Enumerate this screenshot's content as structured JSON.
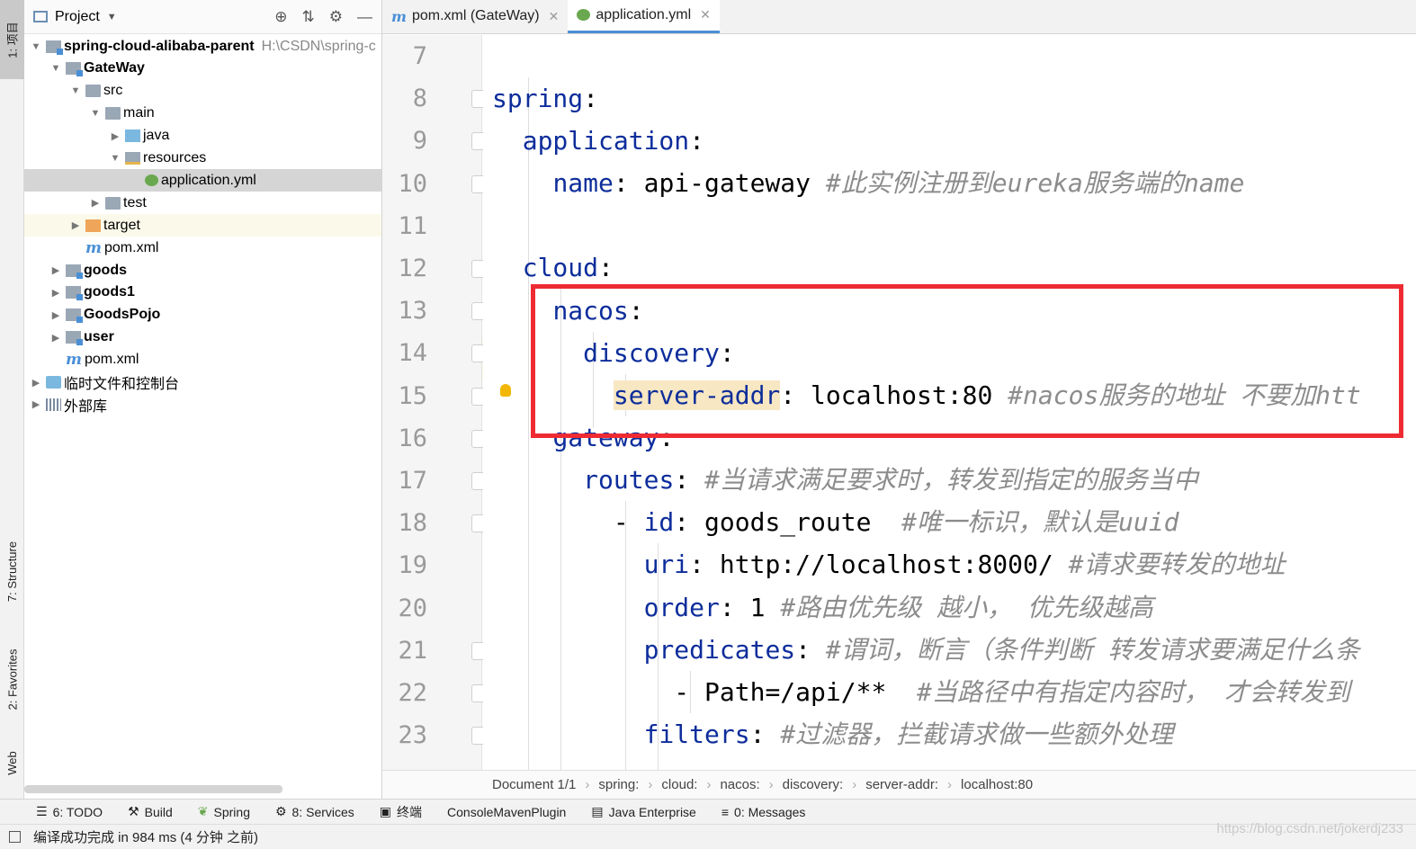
{
  "left_strip": {
    "project_tab": "1: 项目",
    "structure_tab": "7: Structure",
    "favorites_tab": "2: Favorites",
    "web_tab": "Web"
  },
  "project": {
    "title": "Project",
    "tree": [
      {
        "label": "spring-cloud-alibaba-parent",
        "path": "H:\\CSDN\\spring-c",
        "icon": "module-folder-icon",
        "expanded": true
      },
      {
        "label": "GateWay",
        "icon": "module-folder-icon",
        "expanded": true
      },
      {
        "label": "src",
        "icon": "folder-icon",
        "expanded": true
      },
      {
        "label": "main",
        "icon": "folder-icon",
        "expanded": true
      },
      {
        "label": "java",
        "icon": "source-folder-icon",
        "expanded": false
      },
      {
        "label": "resources",
        "icon": "resources-folder-icon",
        "expanded": true
      },
      {
        "label": "application.yml",
        "icon": "yml-file-icon",
        "selected": true
      },
      {
        "label": "test",
        "icon": "folder-icon",
        "expanded": false
      },
      {
        "label": "target",
        "icon": "excluded-folder-icon",
        "expanded": false
      },
      {
        "label": "pom.xml",
        "icon": "maven-file-icon"
      },
      {
        "label": "goods",
        "icon": "module-folder-icon",
        "expanded": false
      },
      {
        "label": "goods1",
        "icon": "module-folder-icon",
        "expanded": false
      },
      {
        "label": "GoodsPojo",
        "icon": "module-folder-icon",
        "expanded": false
      },
      {
        "label": "user",
        "icon": "module-folder-icon",
        "expanded": false
      },
      {
        "label": "pom.xml",
        "icon": "maven-file-icon"
      },
      {
        "label": "临时文件和控制台",
        "icon": "scratches-icon",
        "expanded": false
      },
      {
        "label": "外部库",
        "icon": "libraries-icon",
        "expanded": false
      }
    ]
  },
  "tabs": [
    {
      "label": "pom.xml (GateWay)",
      "icon": "maven-file-icon",
      "active": false
    },
    {
      "label": "application.yml",
      "icon": "yml-file-icon",
      "active": true
    }
  ],
  "line_numbers": [
    "7",
    "8",
    "9",
    "10",
    "11",
    "12",
    "13",
    "14",
    "15",
    "16",
    "17",
    "18",
    "19",
    "20",
    "21",
    "22",
    "23"
  ],
  "code": {
    "l8_key": "spring",
    "l9_key": "application",
    "l10_key": "name",
    "l10_val": "api-gateway",
    "l10_comment": "#此实例注册到eureka服务端的name",
    "l12_key": "cloud",
    "l13_key": "nacos",
    "l14_key": "discovery",
    "l15_key": "server-addr",
    "l15_val": "localhost:80",
    "l15_comment": "#nacos服务的地址 不要加htt",
    "l16_key": "gateway",
    "l17_key": "routes",
    "l17_comment": "#当请求满足要求时，转发到指定的服务当中",
    "l18_key": "id",
    "l18_val": "goods_route",
    "l18_comment": "#唯一标识，默认是uuid",
    "l19_key": "uri",
    "l19_val": "http://localhost:8000/",
    "l19_comment": "#请求要转发的地址",
    "l20_key": "order",
    "l20_val": "1",
    "l20_comment": "#路由优先级 越小， 优先级越高",
    "l21_key": "predicates",
    "l21_comment": "#谓词，断言（条件判断 转发请求要满足什么条",
    "l22_val": "Path=/api/**",
    "l22_comment": "#当路径中有指定内容时， 才会转发到",
    "l23_key": "filters",
    "l23_comment": "#过滤器，拦截请求做一些额外处理"
  },
  "breadcrumb": [
    "Document 1/1",
    "spring:",
    "cloud:",
    "nacos:",
    "discovery:",
    "server-addr:",
    "localhost:80"
  ],
  "bottom_toolbar": [
    "6: TODO",
    "Build",
    "Spring",
    "8: Services",
    "终端",
    "ConsoleMavenPlugin",
    "Java Enterprise",
    "0: Messages"
  ],
  "status": {
    "message": "编译成功完成 in 984 ms (4 分钟 之前)",
    "watermark": "https://blog.csdn.net/jokerdj233"
  },
  "colors": {
    "key": "#0d2d9b",
    "comment": "#8c8c8c",
    "highlight_box": "#ee2b33",
    "current_line": "#fcf9e6"
  }
}
